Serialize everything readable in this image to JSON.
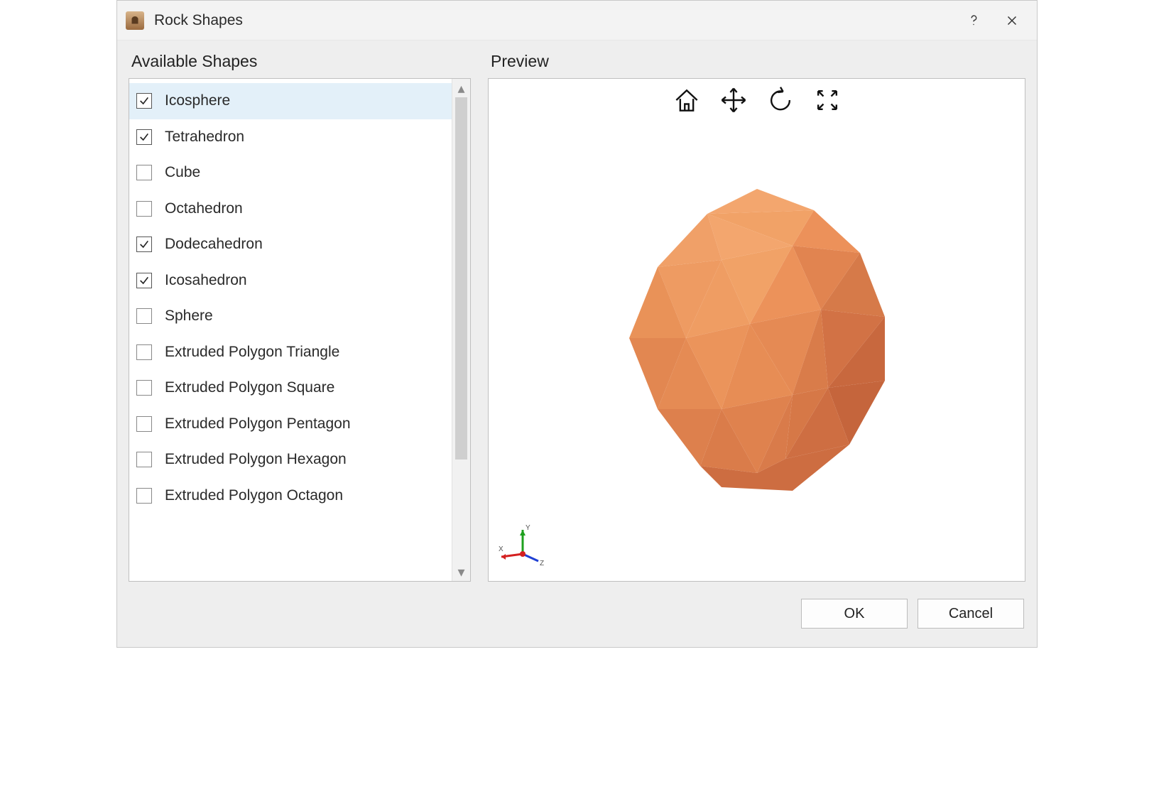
{
  "window": {
    "title": "Rock Shapes"
  },
  "labels": {
    "available": "Available Shapes",
    "preview": "Preview"
  },
  "list": {
    "items": [
      {
        "label": "Icosphere",
        "checked": true,
        "selected": true
      },
      {
        "label": "Tetrahedron",
        "checked": true,
        "selected": false
      },
      {
        "label": "Cube",
        "checked": false,
        "selected": false
      },
      {
        "label": "Octahedron",
        "checked": false,
        "selected": false
      },
      {
        "label": "Dodecahedron",
        "checked": true,
        "selected": false
      },
      {
        "label": "Icosahedron",
        "checked": true,
        "selected": false
      },
      {
        "label": "Sphere",
        "checked": false,
        "selected": false
      },
      {
        "label": "Extruded Polygon Triangle",
        "checked": false,
        "selected": false
      },
      {
        "label": "Extruded Polygon Square",
        "checked": false,
        "selected": false
      },
      {
        "label": "Extruded Polygon Pentagon",
        "checked": false,
        "selected": false
      },
      {
        "label": "Extruded Polygon Hexagon",
        "checked": false,
        "selected": false
      },
      {
        "label": "Extruded Polygon Octagon",
        "checked": false,
        "selected": false
      }
    ]
  },
  "toolbar3d": {
    "home": "home-icon",
    "pan": "move-icon",
    "rotate": "rotate-ccw-icon",
    "fit": "expand-icon"
  },
  "preview": {
    "model_color_light": "#f5aa71",
    "model_color_mid": "#e88a53",
    "model_color_dark": "#c8683e",
    "axis_labels": {
      "x": "X",
      "y": "Y",
      "z": "Z"
    }
  },
  "buttons": {
    "ok": "OK",
    "cancel": "Cancel"
  }
}
